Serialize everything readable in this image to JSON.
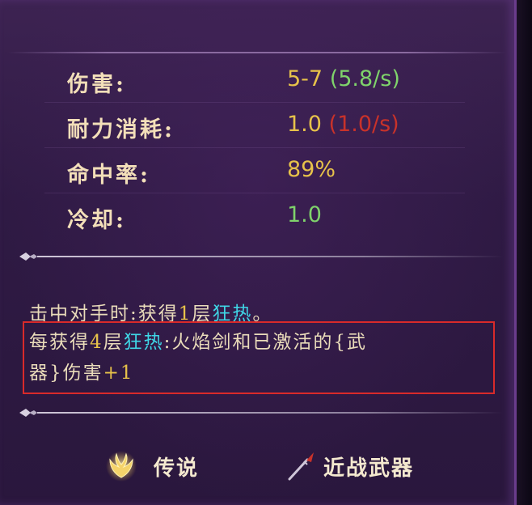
{
  "title": "",
  "stats": [
    {
      "label": "伤害:",
      "value": "5-7",
      "extra": "(5.8/s)"
    },
    {
      "label": "耐力消耗:",
      "value": "1.0",
      "extra": "(1.0/s)"
    },
    {
      "label": "命中率:",
      "value": "89%",
      "extra": ""
    },
    {
      "label": "冷却:",
      "value": "1.0",
      "extra": ""
    }
  ],
  "description": {
    "line1": {
      "a": "击中对手时:获得",
      "num": "1",
      "b": "层",
      "keyword": "狂热",
      "c": "。"
    },
    "line2": {
      "a": "每获得",
      "num": "4",
      "b": "层",
      "keyword": "狂热",
      "c": ":火焰剑和已激活的{武"
    },
    "line3": {
      "a": "器}伤害",
      "bonus": "+1"
    }
  },
  "footer": {
    "rarity_label": "传说",
    "rarity_icon": "legendary-emblem-icon",
    "type_label": "近战武器",
    "type_icon": "spear-icon"
  },
  "colors": {
    "label": "#f3dfb9",
    "value_gold": "#e7c24a",
    "value_green": "#7fd36b",
    "value_red": "#c8322a",
    "keyword_cyan": "#3fd6e6",
    "highlight_border": "#d92a2a"
  }
}
